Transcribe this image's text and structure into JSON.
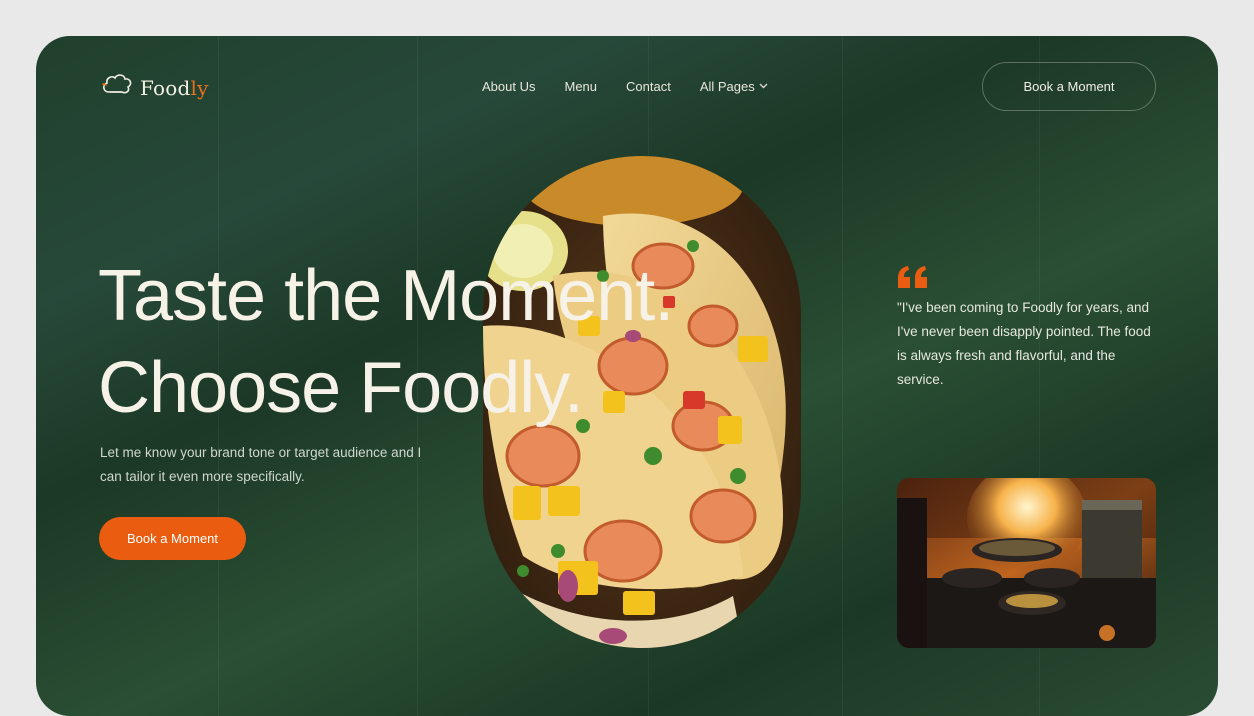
{
  "brand": {
    "name_main": "Food",
    "name_accent": "ly",
    "logo_icon": "chef-hat-icon",
    "accent_color": "#e8721c"
  },
  "nav": {
    "items": [
      {
        "label": "About Us"
      },
      {
        "label": "Menu"
      },
      {
        "label": "Contact"
      },
      {
        "label": "All Pages",
        "icon": "chevron-down-icon"
      }
    ],
    "cta_label": "Book a Moment"
  },
  "hero": {
    "title_line1": "Taste the Moment.",
    "title_line2": "Choose Foodly.",
    "subtitle": "Let me know your brand tone or target audience and I can tailor it even more specifically.",
    "cta_label": "Book a Moment",
    "cta_color": "#ea5d10",
    "image": "shrimp-tacos-image"
  },
  "testimonial": {
    "quote_icon": "quote-icon",
    "text": "\"I've been coming to Foodly for years, and I've never been disapply pointed. The food is always fresh and flavorful, and the service.",
    "image": "kitchen-flames-image"
  },
  "colors": {
    "background": "#1f3d2a",
    "accent": "#ea5d10",
    "text": "#f6f2e8"
  }
}
